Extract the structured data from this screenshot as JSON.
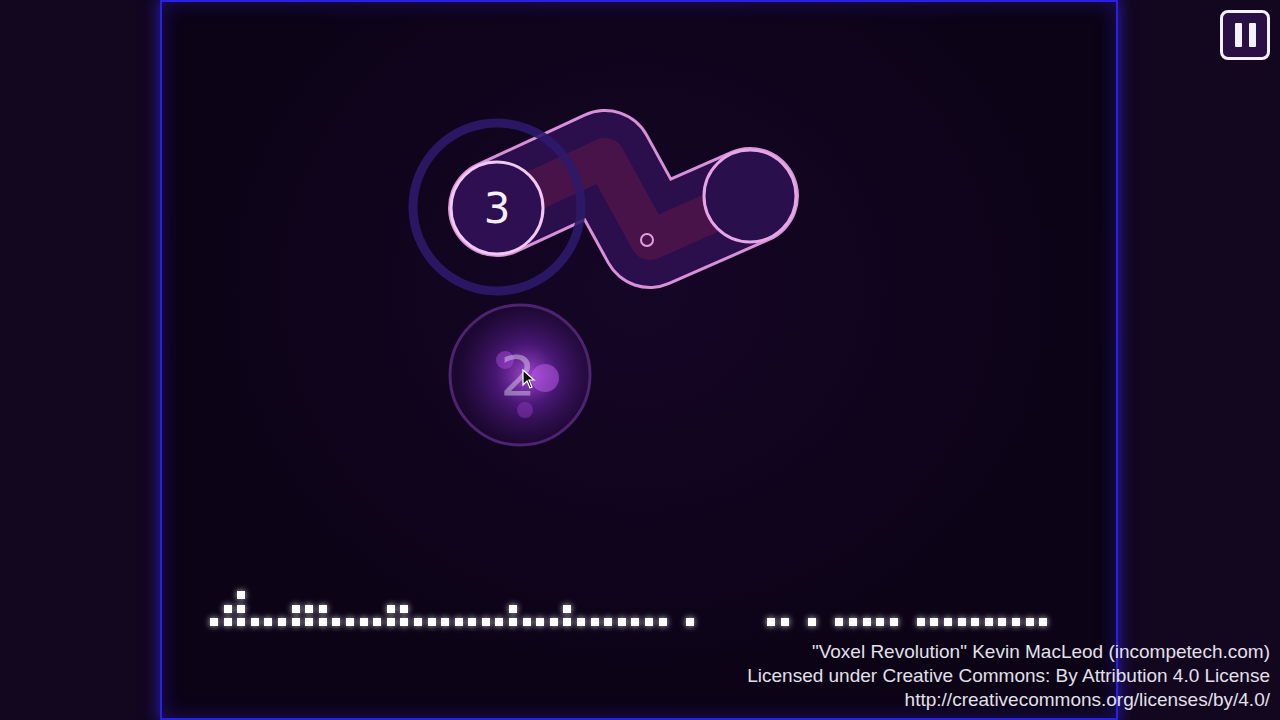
{
  "hit_objects": [
    {
      "kind": "slider",
      "number": "3",
      "approach": true,
      "faded": false
    },
    {
      "kind": "circle",
      "number": "2",
      "approach": false,
      "faded": true
    }
  ],
  "visualizer": {
    "columns": [
      1,
      2,
      3,
      1,
      1,
      1,
      2,
      2,
      2,
      1,
      1,
      1,
      1,
      2,
      2,
      1,
      1,
      1,
      1,
      1,
      1,
      1,
      2,
      1,
      1,
      1,
      2,
      1,
      1,
      1,
      1,
      1,
      1,
      1,
      0,
      1,
      0,
      0,
      0,
      0,
      0,
      1,
      1,
      0,
      1,
      0,
      1,
      1,
      1,
      1,
      1,
      0,
      1,
      1,
      1,
      1,
      1,
      1,
      1,
      1,
      1,
      1
    ]
  },
  "credits": [
    "\"Voxel Revolution\" Kevin MacLeod (incompetech.com)",
    "Licensed under Creative Commons: By Attribution 4.0 License",
    "http://creativecommons.org/licenses/by/4.0/"
  ]
}
